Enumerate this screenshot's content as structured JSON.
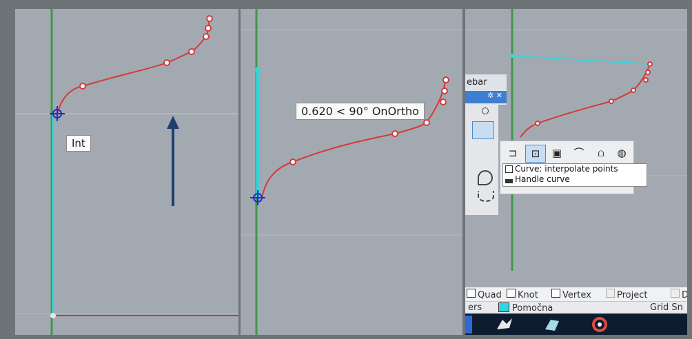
{
  "panels": {
    "left": {
      "tooltip": "Int"
    },
    "middle": {
      "tooltip": "0.620 < 90° OnOrtho"
    },
    "right": {
      "toolbar_title": "ebar",
      "toolbar_controls": "✲ ✕",
      "context_menu": [
        "Curve: interpolate points",
        "Handle curve"
      ],
      "osnap": {
        "quad": "Quad",
        "knot": "Knot",
        "vertex": "Vertex",
        "project": "Project",
        "d": "D"
      },
      "layer": {
        "left_text": "ers",
        "layer_name": "Pomočna linija",
        "right_text": "Grid Sn"
      }
    }
  },
  "colors": {
    "viewport": "#a3a9b0",
    "curve": "#d23b3b",
    "axis_green": "#3a9a48",
    "highlight_cyan": "#38d3de",
    "arrow": "#1d3f6e",
    "snap_marker": "#1f2bd6",
    "taskbar": "#0d1c2f"
  },
  "icons": [
    "int-snap-marker",
    "up-arrow-icon",
    "curve-interpolate-icon",
    "handle-curve-icon",
    "gear-icon",
    "close-icon",
    "rhino-taskbar-icon",
    "app-taskbar-icon",
    "chrome-taskbar-icon"
  ]
}
